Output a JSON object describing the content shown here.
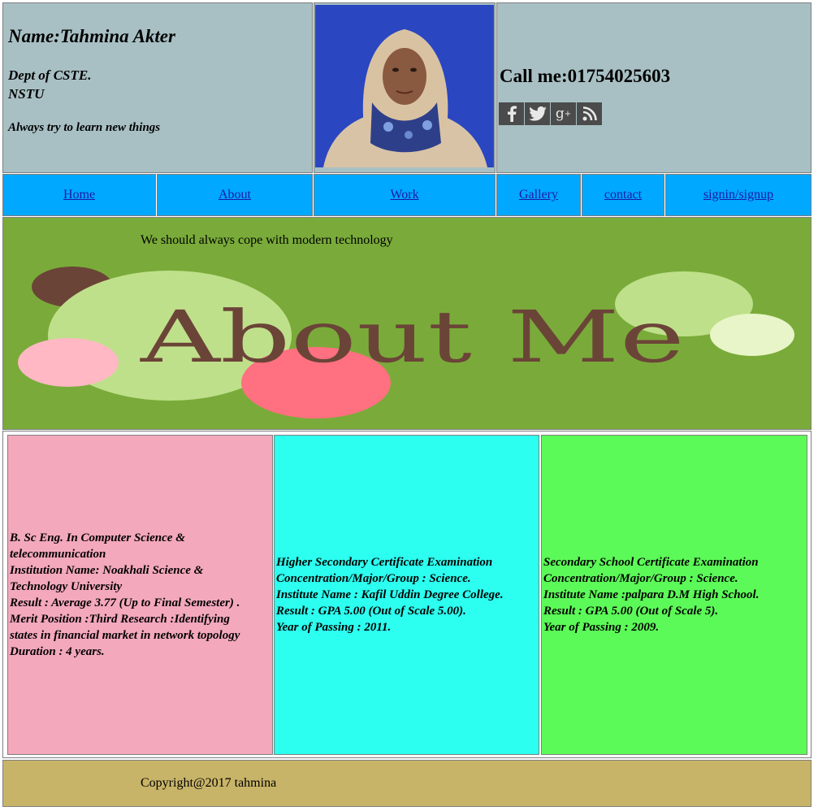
{
  "header": {
    "name": "Name:Tahmina Akter",
    "dept_line1": "Dept of CSTE.",
    "dept_line2": "NSTU",
    "motto": "Always try to learn new things",
    "call": "Call me:01754025603",
    "social_icons": [
      "facebook-icon",
      "twitter-icon",
      "google-plus-icon",
      "rss-icon"
    ]
  },
  "nav": {
    "items": [
      "Home",
      "About",
      "Work",
      "Gallery",
      "contact",
      "signin/signup"
    ]
  },
  "banner": {
    "tagline": "We should always cope with modern technology",
    "title": "About Me"
  },
  "education": [
    {
      "lines": [
        "B. Sc Eng. In Computer Science &",
        "telecommunication",
        "Institution Name: Noakhali Science &",
        "Technology University",
        "Result : Average 3.77 (Up to Final Semester) .",
        "Merit Position :Third Research :Identifying",
        "states in financial market in network topology",
        "Duration : 4 years."
      ]
    },
    {
      "lines": [
        "Higher Secondary Certificate Examination",
        "Concentration/Major/Group : Science.",
        "Institute Name : Kafil Uddin Degree College.",
        "Result : GPA 5.00 (Out of Scale 5.00).",
        "Year of Passing : 2011."
      ]
    },
    {
      "lines": [
        "Secondary School Certificate Examination",
        "Concentration/Major/Group : Science.",
        "Institute Name :palpara D.M High School.",
        "Result : GPA 5.00 (Out of Scale 5).",
        "Year of Passing : 2009."
      ]
    }
  ],
  "footer": {
    "copyright": "Copyright@2017 tahmina"
  },
  "colors": {
    "header_bg": "#a8c0c4",
    "nav_bg": "#00a8ff",
    "banner_bg": "#7aab3a",
    "col1_bg": "#f4a8bc",
    "col2_bg": "#2cfff0",
    "col3_bg": "#5cfa58",
    "footer_bg": "#c8b468"
  }
}
